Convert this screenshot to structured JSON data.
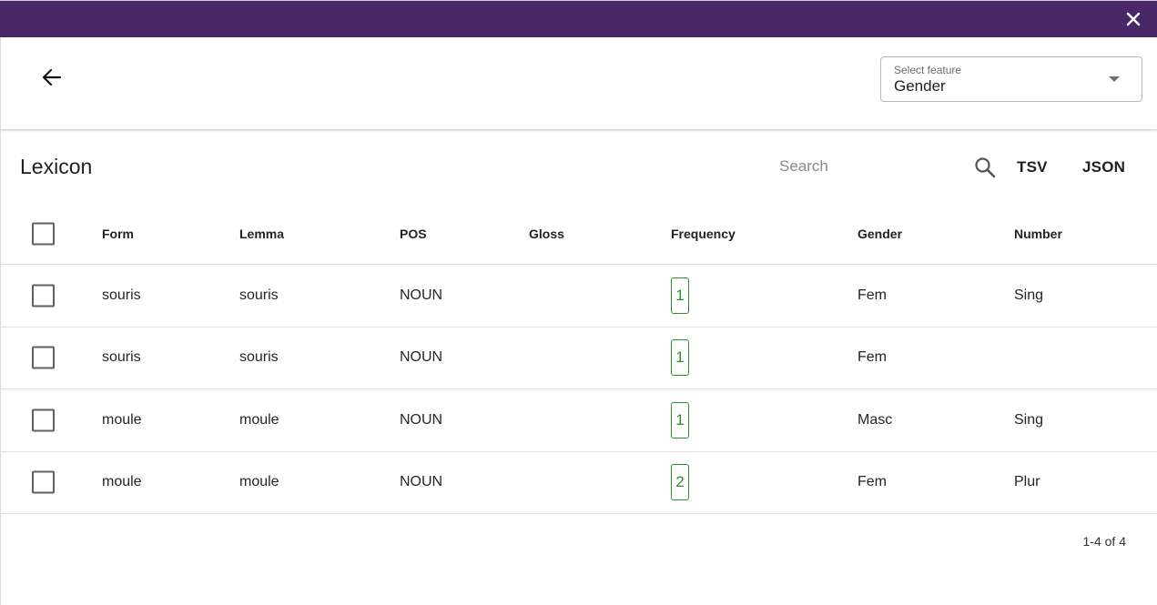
{
  "header": {
    "select_feature": {
      "label": "Select feature",
      "value": "Gender"
    }
  },
  "lexicon": {
    "title": "Lexicon",
    "search": {
      "placeholder": "Search",
      "value": ""
    },
    "export_tsv": "TSV",
    "export_json": "JSON",
    "columns": {
      "form": "Form",
      "lemma": "Lemma",
      "pos": "POS",
      "gloss": "Gloss",
      "frequency": "Frequency",
      "gender": "Gender",
      "number": "Number"
    },
    "rows": [
      {
        "form": "souris",
        "lemma": "souris",
        "pos": "NOUN",
        "gloss": "",
        "frequency": "1",
        "gender": "Fem",
        "number": "Sing"
      },
      {
        "form": "souris",
        "lemma": "souris",
        "pos": "NOUN",
        "gloss": "",
        "frequency": "1",
        "gender": "Fem",
        "number": ""
      },
      {
        "form": "moule",
        "lemma": "moule",
        "pos": "NOUN",
        "gloss": "",
        "frequency": "1",
        "gender": "Masc",
        "number": "Sing"
      },
      {
        "form": "moule",
        "lemma": "moule",
        "pos": "NOUN",
        "gloss": "",
        "frequency": "2",
        "gender": "Fem",
        "number": "Plur"
      }
    ],
    "pagination": "1-4 of 4"
  },
  "icons": {
    "close": "close-icon",
    "back": "arrow-back-icon",
    "dropdown": "chevron-down-icon",
    "search": "search-icon"
  },
  "colors": {
    "topbar": "#4a2768",
    "frequency_badge": "#2e8b2e"
  }
}
